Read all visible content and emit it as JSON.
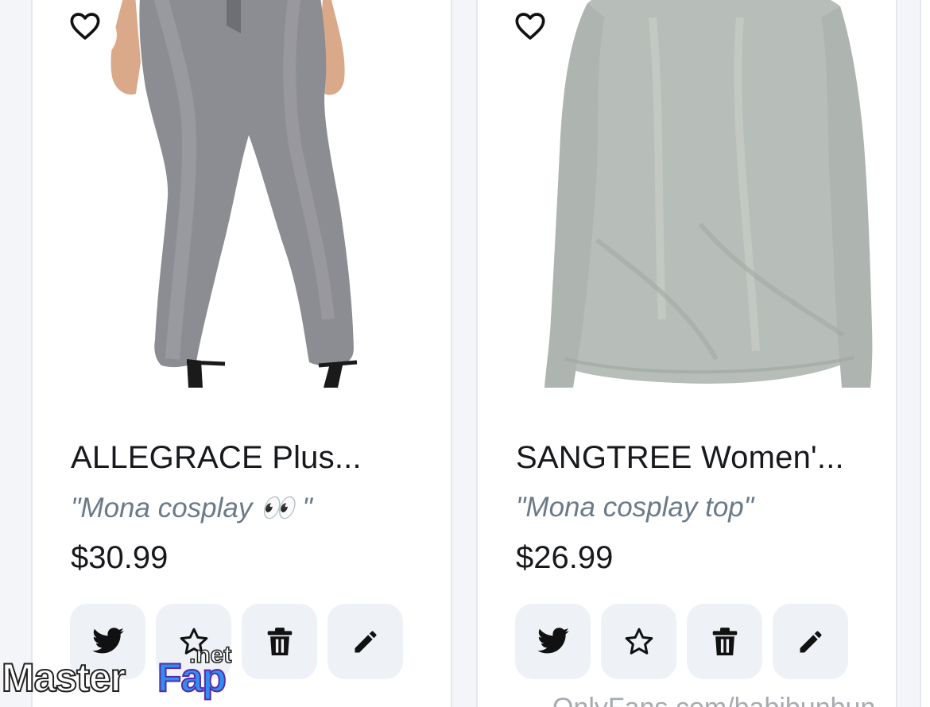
{
  "products": [
    {
      "title": "ALLEGRACE Plus...",
      "note": "\"Mona cosplay 👀 \"",
      "price": "$30.99",
      "favorite_icon": "heart-outline-icon",
      "actions": [
        "twitter-icon",
        "star-icon",
        "trash-icon",
        "pencil-icon"
      ]
    },
    {
      "title": "SANGTREE Women'...",
      "note": "\"Mona cosplay top\"",
      "price": "$26.99",
      "favorite_icon": "heart-outline-icon",
      "actions": [
        "twitter-icon",
        "star-icon",
        "trash-icon",
        "pencil-icon"
      ]
    }
  ],
  "watermark": {
    "master": "Master",
    "fap": "Fap",
    "net": ".net"
  },
  "footer": {
    "link_text": "OnlyFans.com/babibunbun"
  },
  "colors": {
    "background": "#f3f5f8",
    "card": "#ffffff",
    "title": "#17191d",
    "note": "#6b7a89",
    "action_button": "#eef1f6",
    "icon": "#111111"
  }
}
